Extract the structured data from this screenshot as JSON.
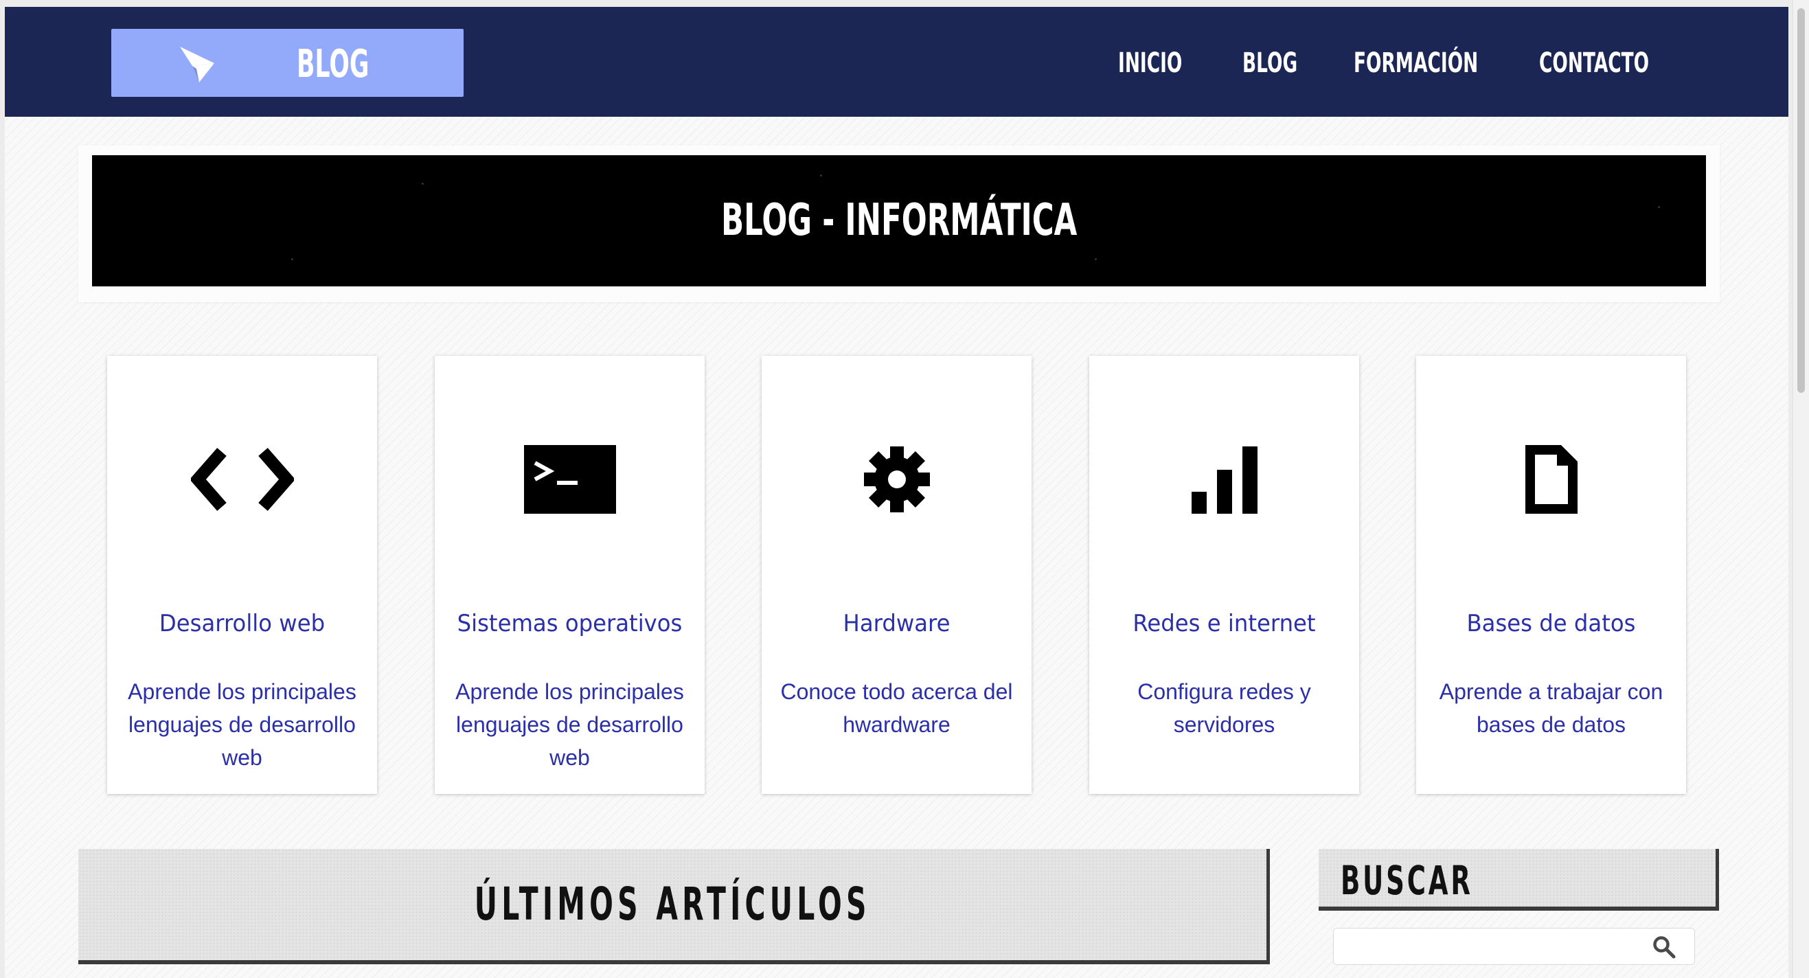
{
  "header": {
    "logo_text": "BLOG",
    "nav": [
      "INICIO",
      "BLOG",
      "FORMACIÓN",
      "CONTACTO"
    ],
    "colors": {
      "bar": "#1c2654",
      "logo_bg": "#93a9f9",
      "text": "#ffffff"
    }
  },
  "hero": {
    "title": "BLOG - INFORMÁTICA"
  },
  "categories": [
    {
      "icon": "code-icon",
      "title": "Desarrollo web",
      "description": "Aprende los principales lenguajes de desarrollo web"
    },
    {
      "icon": "terminal-icon",
      "title": "Sistemas operativos",
      "description": "Aprende los principales lenguajes de desarrollo web"
    },
    {
      "icon": "gear-icon",
      "title": "Hardware",
      "description": "Conoce todo acerca del hwardware"
    },
    {
      "icon": "signal-bars-icon",
      "title": "Redes e internet",
      "description": "Configura redes y servidores"
    },
    {
      "icon": "document-icon",
      "title": "Bases de datos",
      "description": "Aprende a trabajar con bases de datos"
    }
  ],
  "latest": {
    "title": "ÚLTIMOS ARTÍCULOS"
  },
  "sidebar": {
    "search_title": "BUSCAR",
    "search_value": "",
    "search_icon": "search-icon"
  },
  "accent_color": "#2b2fa8"
}
